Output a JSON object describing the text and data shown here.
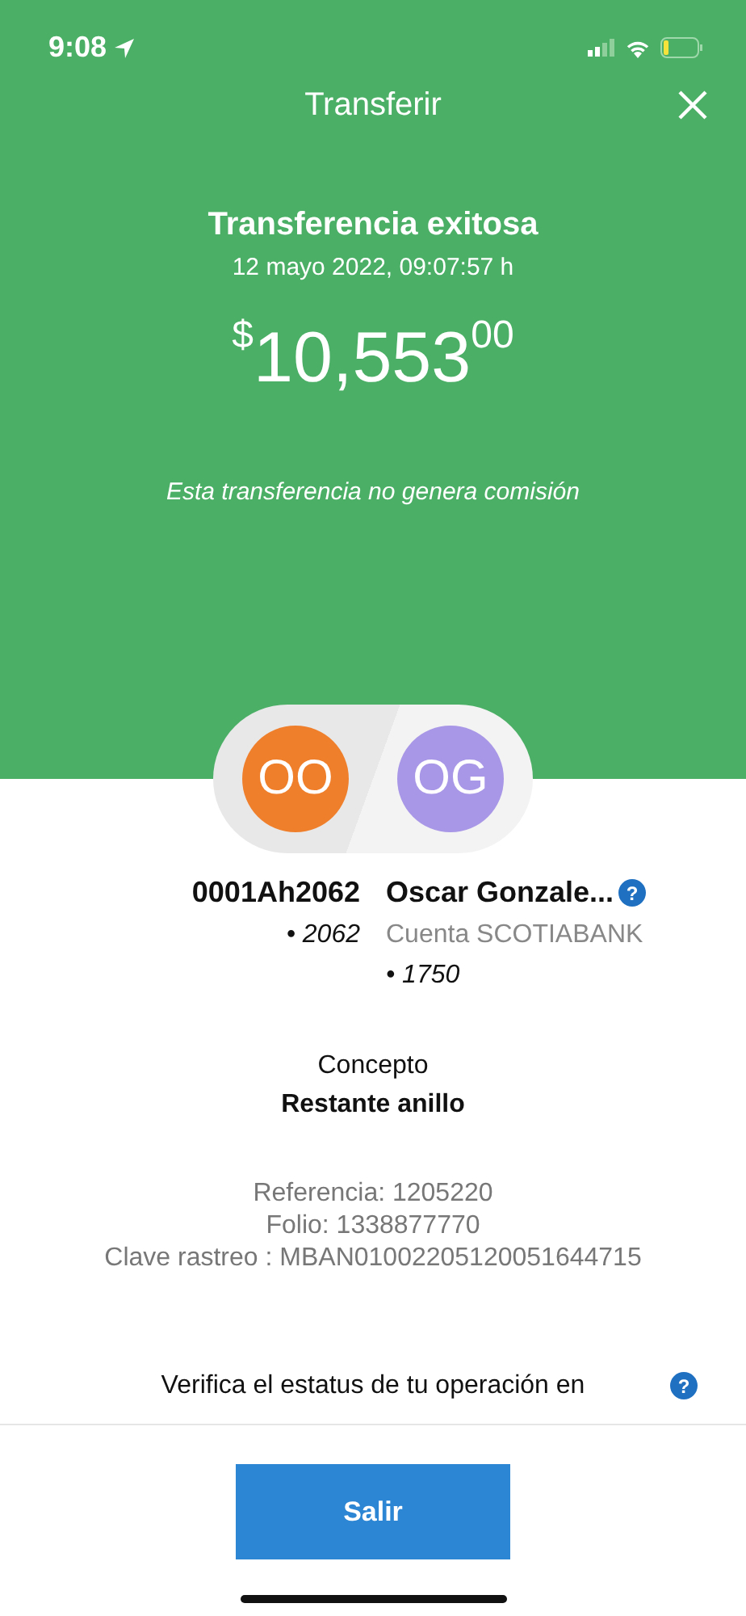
{
  "status_bar": {
    "time": "9:08"
  },
  "header": {
    "title": "Transferir"
  },
  "result": {
    "title": "Transferencia exitosa",
    "date": "12 mayo 2022, 09:07:57 h",
    "amount": {
      "currency": "$",
      "whole": "10,553",
      "cents": "00"
    },
    "note": "Esta transferencia no genera comisión"
  },
  "accounts": [
    {
      "initials": "OO",
      "color": "#f07f2c",
      "name": "0001Ah2062",
      "lines": [
        {
          "kind": "number",
          "text": "• 2062"
        }
      ]
    },
    {
      "initials": "OG",
      "color": "#a896e6",
      "name": "Oscar Gonzale...",
      "lines": [
        {
          "kind": "bank",
          "text": "Cuenta SCOTIABANK"
        },
        {
          "kind": "number",
          "text": "• 1750"
        }
      ],
      "help": "?"
    }
  ],
  "concept": {
    "label": "Concepto",
    "value": "Restante anillo"
  },
  "details": [
    "Referencia: 1205220",
    "Folio: 1338877770",
    "Clave rastreo : MBAN01002205120051644715"
  ],
  "verify": {
    "text": "Verifica el estatus de tu operación en",
    "help": "?"
  },
  "button": "Salir"
}
